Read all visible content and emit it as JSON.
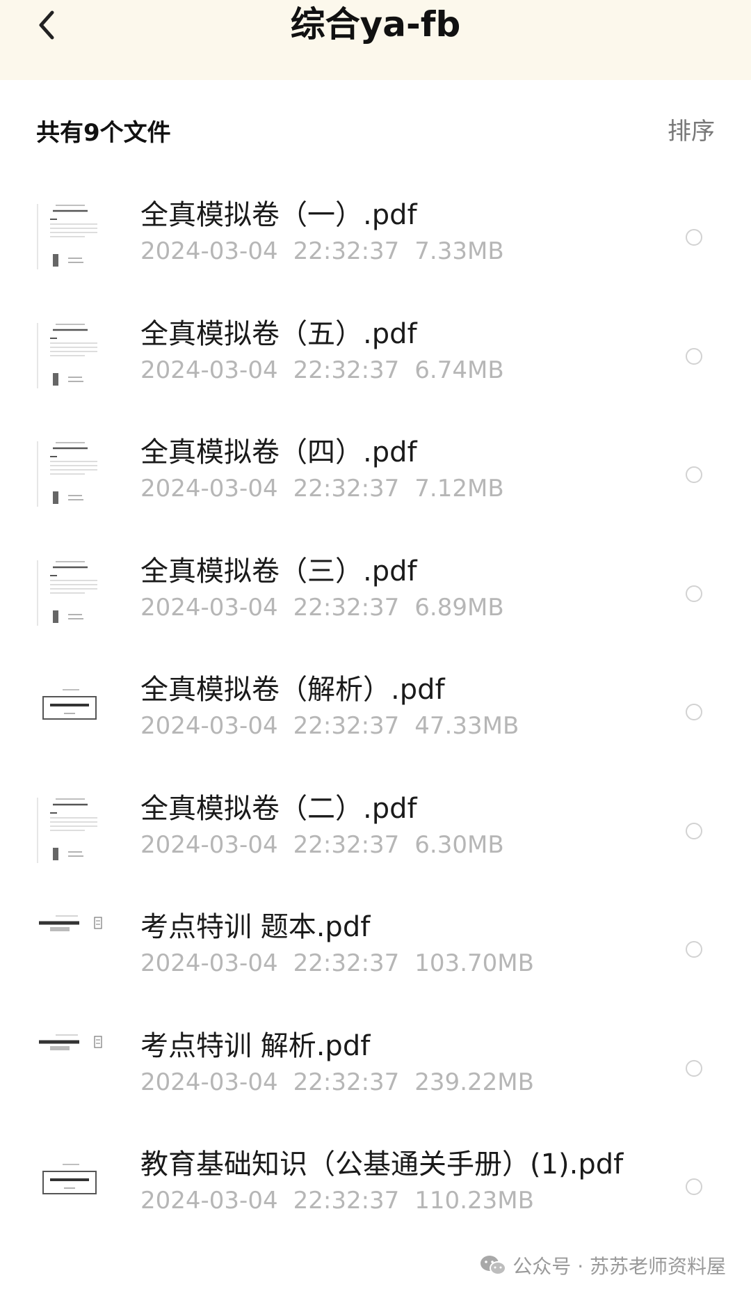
{
  "header": {
    "title": "综合ya-fb",
    "back_icon": "chevron-left-icon"
  },
  "summary": {
    "count_label": "共有9个文件",
    "sort_label": "排序"
  },
  "files": [
    {
      "name": "全真模拟卷（一）.pdf",
      "date": "2024-03-04",
      "time": "22:32:37",
      "size": "7.33MB",
      "thumb": "exam-page"
    },
    {
      "name": "全真模拟卷（五）.pdf",
      "date": "2024-03-04",
      "time": "22:32:37",
      "size": "6.74MB",
      "thumb": "exam-page"
    },
    {
      "name": "全真模拟卷（四）.pdf",
      "date": "2024-03-04",
      "time": "22:32:37",
      "size": "7.12MB",
      "thumb": "exam-page"
    },
    {
      "name": "全真模拟卷（三）.pdf",
      "date": "2024-03-04",
      "time": "22:32:37",
      "size": "6.89MB",
      "thumb": "exam-page"
    },
    {
      "name": "全真模拟卷（解析）.pdf",
      "date": "2024-03-04",
      "time": "22:32:37",
      "size": "47.33MB",
      "thumb": "cover-box"
    },
    {
      "name": "全真模拟卷（二）.pdf",
      "date": "2024-03-04",
      "time": "22:32:37",
      "size": "6.30MB",
      "thumb": "exam-page"
    },
    {
      "name": "考点特训 题本.pdf",
      "date": "2024-03-04",
      "time": "22:32:37",
      "size": "103.70MB",
      "thumb": "book-cover"
    },
    {
      "name": "考点特训  解析.pdf",
      "date": "2024-03-04",
      "time": "22:32:37",
      "size": "239.22MB",
      "thumb": "book-cover"
    },
    {
      "name": "教育基础知识（公基通关手册）(1).pdf",
      "date": "2024-03-04",
      "time": "22:32:37",
      "size": "110.23MB",
      "thumb": "cover-box"
    }
  ],
  "watermark": {
    "text": "公众号 · 苏苏老师资料屋",
    "icon": "wechat-icon"
  }
}
